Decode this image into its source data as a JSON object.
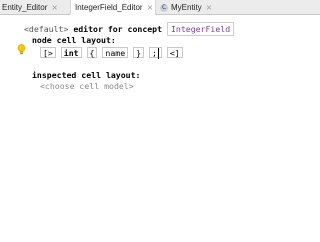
{
  "tabs": [
    {
      "label": "Entity_Editor",
      "icon": "E",
      "close": "×"
    },
    {
      "label": "IntegerField_Editor",
      "icon": "E",
      "close": "×"
    },
    {
      "label": "MyEntity",
      "icon": "C",
      "close": "×"
    }
  ],
  "editor": {
    "line1": {
      "default_tag": "<default>",
      "editor_for_concept": "editor for concept",
      "concept_name": "IntegerField"
    },
    "line2": {
      "node_cell_layout": "node cell layout:"
    },
    "line3": {
      "open": "[>",
      "int": "int",
      "lbrace": "{",
      "name": "name",
      "rbrace": "}",
      "semicolon": ";",
      "close": "<]"
    },
    "line4": {
      "inspected_cell_layout": "inspected cell layout:"
    },
    "line5": {
      "choose_cell_model": "<choose cell model>"
    }
  },
  "colors": {
    "keyword": "#000080",
    "concept_ref": "#7a3e9d",
    "muted": "#8a8a8a",
    "bulb": "#f5c518"
  }
}
